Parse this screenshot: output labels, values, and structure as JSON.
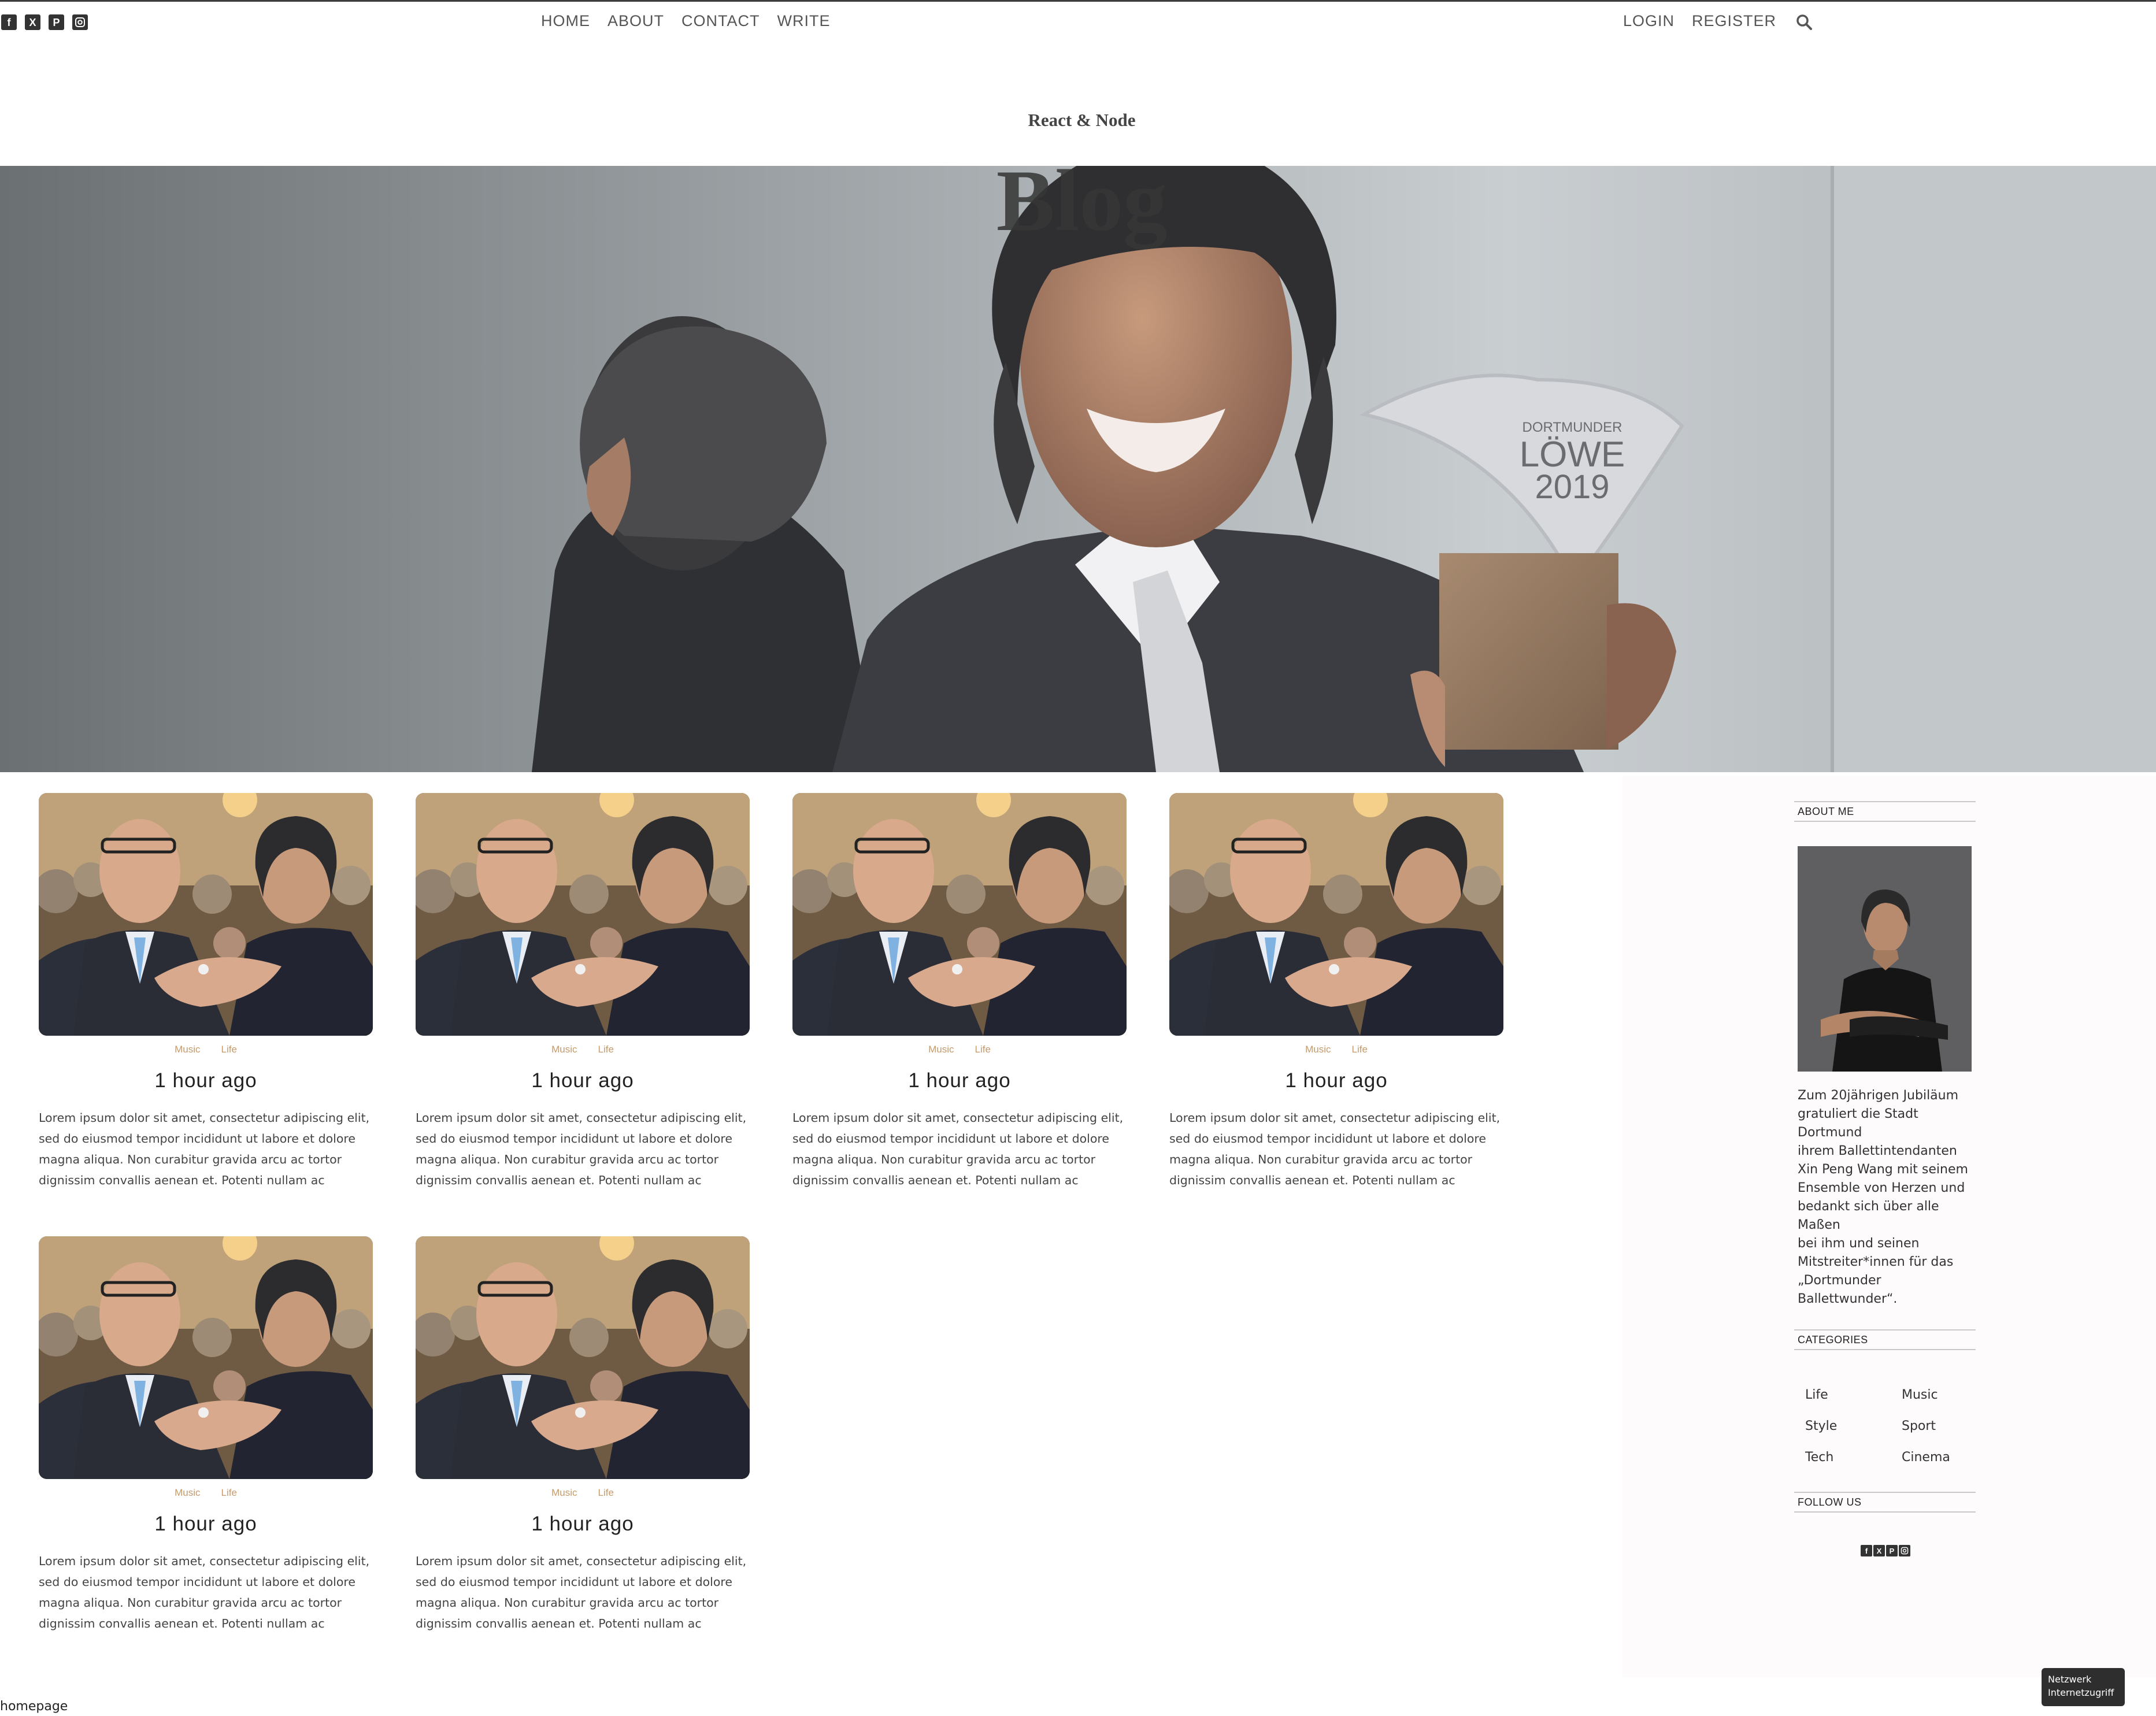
{
  "social_icons": [
    "facebook-icon",
    "x-icon",
    "pinterest-icon",
    "instagram-icon"
  ],
  "nav": {
    "items": [
      {
        "label": "HOME"
      },
      {
        "label": "ABOUT"
      },
      {
        "label": "CONTACT"
      },
      {
        "label": "WRITE"
      }
    ],
    "login": "LOGIN",
    "register": "REGISTER"
  },
  "header": {
    "small_title": "React & Node",
    "large_title": "Blog",
    "hero_trophy_text": [
      "DORTMUNDER",
      "LÖWE",
      "2019"
    ]
  },
  "posts": [
    {
      "categories": [
        "Music",
        "Life"
      ],
      "title": "1 hour ago",
      "desc": "Lorem ipsum dolor sit amet, consectetur adipiscing elit, sed do eiusmod tempor incididunt ut labore et dolore magna aliqua. Non curabitur gravida arcu ac tortor dignissim convallis aenean et. Potenti nullam ac tortor…"
    },
    {
      "categories": [
        "Music",
        "Life"
      ],
      "title": "1 hour ago",
      "desc": "Lorem ipsum dolor sit amet, consectetur adipiscing elit, sed do eiusmod tempor incididunt ut labore et dolore magna aliqua. Non curabitur gravida arcu ac tortor dignissim convallis aenean et. Potenti nullam ac tortor…"
    },
    {
      "categories": [
        "Music",
        "Life"
      ],
      "title": "1 hour ago",
      "desc": "Lorem ipsum dolor sit amet, consectetur adipiscing elit, sed do eiusmod tempor incididunt ut labore et dolore magna aliqua. Non curabitur gravida arcu ac tortor dignissim convallis aenean et. Potenti nullam ac tortor…"
    },
    {
      "categories": [
        "Music",
        "Life"
      ],
      "title": "1 hour ago",
      "desc": "Lorem ipsum dolor sit amet, consectetur adipiscing elit, sed do eiusmod tempor incididunt ut labore et dolore magna aliqua. Non curabitur gravida arcu ac tortor dignissim convallis aenean et. Potenti nullam ac tortor…"
    },
    {
      "categories": [
        "Music",
        "Life"
      ],
      "title": "1 hour ago",
      "desc": "Lorem ipsum dolor sit amet, consectetur adipiscing elit, sed do eiusmod tempor incididunt ut labore et dolore magna aliqua. Non curabitur gravida arcu ac tortor dignissim convallis aenean et. Potenti nullam ac tortor…"
    },
    {
      "categories": [
        "Music",
        "Life"
      ],
      "title": "1 hour ago",
      "desc": "Lorem ipsum dolor sit amet, consectetur adipiscing elit, sed do eiusmod tempor incididunt ut labore et dolore magna aliqua. Non curabitur gravida arcu ac tortor dignissim convallis aenean et. Potenti nullam ac tortor…"
    }
  ],
  "sidebar": {
    "about_title": "ABOUT ME",
    "about_lines": [
      "Zum 20jährigen Jubiläum",
      "gratuliert die Stadt",
      "Dortmund",
      "ihrem Ballettintendanten",
      "Xin Peng Wang mit seinem",
      "Ensemble von Herzen und",
      "bedankt sich über alle",
      "Maßen",
      "bei ihm und seinen",
      "Mitstreiter*innen für das",
      "„Dortmunder",
      "Ballettwunder“."
    ],
    "categories_title": "CATEGORIES",
    "categories": [
      "Life",
      "Music",
      "Style",
      "Sport",
      "Tech",
      "Cinema"
    ],
    "follow_title": "FOLLOW US"
  },
  "status": {
    "url": "homepage",
    "network_line1": "Netzwerk",
    "network_line2": "Internetzugriff"
  },
  "colors": {
    "accent_category": "#c49a6c",
    "text": "#333333",
    "topline": "#3d3d3d"
  }
}
